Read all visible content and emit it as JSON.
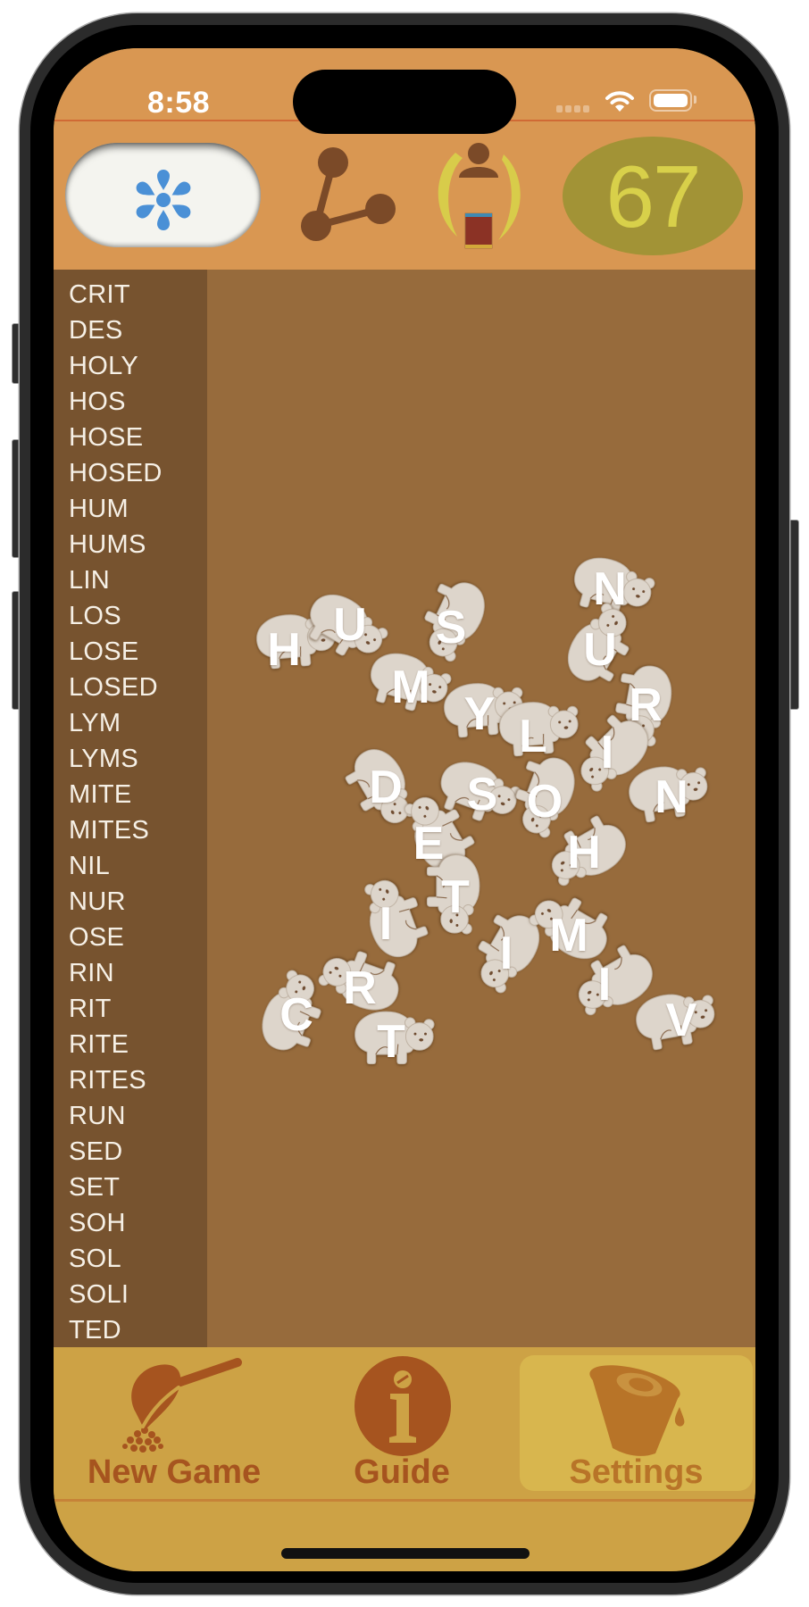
{
  "status_bar": {
    "time": "8:58",
    "signal_icon": "cellular-signal-icon",
    "wifi_icon": "wifi-icon",
    "battery_icon": "battery-icon"
  },
  "header": {
    "hint_button": {
      "icon": "flower-asterisk-icon"
    },
    "share_button": {
      "icon": "molecule-share-icon"
    },
    "player_button": {
      "icon": "person-card-icon"
    },
    "score": {
      "value": "67"
    }
  },
  "word_list": [
    "CRIT",
    "DES",
    "HOLY",
    "HOS",
    "HOSE",
    "HOSED",
    "HUM",
    "HUMS",
    "LIN",
    "LOS",
    "LOSE",
    "LOSED",
    "LYM",
    "LYMS",
    "MITE",
    "MITES",
    "NIL",
    "NUR",
    "OSE",
    "RIN",
    "RIT",
    "RITE",
    "RITES",
    "RUN",
    "SED",
    "SET",
    "SOH",
    "SOL",
    "SOLI",
    "TED"
  ],
  "board": {
    "tile_icon": "bear-tile-icon",
    "tiles": [
      {
        "letter": "H"
      },
      {
        "letter": "U"
      },
      {
        "letter": "S"
      },
      {
        "letter": "M"
      },
      {
        "letter": "Y"
      },
      {
        "letter": "L"
      },
      {
        "letter": "N"
      },
      {
        "letter": "U"
      },
      {
        "letter": "R"
      },
      {
        "letter": "I"
      },
      {
        "letter": "N"
      },
      {
        "letter": "D"
      },
      {
        "letter": "S"
      },
      {
        "letter": "O"
      },
      {
        "letter": "E"
      },
      {
        "letter": "H"
      },
      {
        "letter": "T"
      },
      {
        "letter": "I"
      },
      {
        "letter": "I"
      },
      {
        "letter": "M"
      },
      {
        "letter": "I"
      },
      {
        "letter": "V"
      },
      {
        "letter": "R"
      },
      {
        "letter": "C"
      },
      {
        "letter": "T"
      }
    ]
  },
  "tab_bar": {
    "tabs": [
      {
        "label": "New Game",
        "icon": "scoop-icon",
        "selected": false
      },
      {
        "label": "Guide",
        "icon": "info-icon",
        "selected": false
      },
      {
        "label": "Settings",
        "icon": "cup-icon",
        "selected": true
      }
    ]
  },
  "theme": {
    "header": "#D99752",
    "sidebar": "#77532F",
    "board": "#976B3C",
    "tabbar": "#CDA245",
    "tab_selected": "#D8B64E",
    "tab_icon": "#A6541F",
    "score_bg": "#A29336",
    "score_fg": "#D8D04A",
    "accent": "#4A90D6",
    "tile": "#DDD5CB"
  }
}
